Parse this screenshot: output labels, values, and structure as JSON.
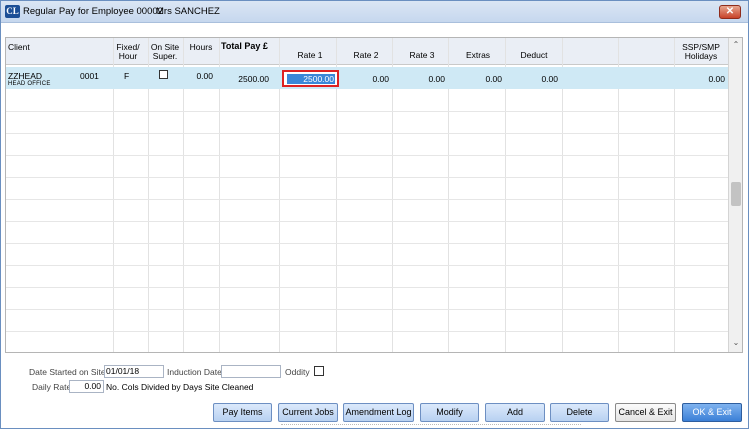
{
  "window": {
    "title": "Regular Pay for Employee 00002",
    "employee_name": "Mrs SANCHEZ",
    "app_icon_text": "CL",
    "close_symbol": "✕"
  },
  "grid": {
    "headers": {
      "client": "Client",
      "fixed_hour_line1": "Fixed/",
      "fixed_hour_line2": "Hour",
      "onsite_line1": "On Site",
      "onsite_line2": "Super.",
      "hours": "Hours",
      "total_pay": "Total Pay £",
      "rate1": "Rate 1",
      "rate2": "Rate 2",
      "rate3": "Rate 3",
      "extras": "Extras",
      "deduct": "Deduct",
      "ssp_line1": "SSP/SMP",
      "ssp_line2": "Holidays"
    },
    "rows": [
      {
        "client": "ZZHEAD",
        "client_sub": "HEAD OFFICE",
        "code": "0001",
        "fixed_hour": "F",
        "onsite_super": false,
        "hours": "0.00",
        "total_pay": "2500.00",
        "rate1": "2500.00",
        "rate2": "0.00",
        "rate3": "0.00",
        "extras": "0.00",
        "deduct": "0.00",
        "ssp_holidays": "0.00"
      }
    ]
  },
  "form": {
    "date_started_label": "Date Started on Site",
    "date_started_value": "01/01/18",
    "induction_date_label": "Induction Date",
    "induction_date_value": "",
    "oddity_label": "Oddity",
    "daily_rate_label": "Daily Rate",
    "daily_rate_value": "0.00",
    "cols_note": "No. Cols Divided by Days Site Cleaned"
  },
  "buttons": {
    "pay_items": "Pay Items",
    "current_jobs": "Current Jobs",
    "amendment_log": "Amendment Log",
    "modify": "Modify",
    "add": "Add",
    "delete": "Delete",
    "cancel_exit": "Cancel & Exit",
    "ok_exit": "OK & Exit"
  },
  "colors": {
    "selected_row": "#cfe9f5",
    "selection_highlight": "#3a87d8",
    "focus_outline": "#dd2222",
    "button_blue": "#b8d1f1"
  }
}
